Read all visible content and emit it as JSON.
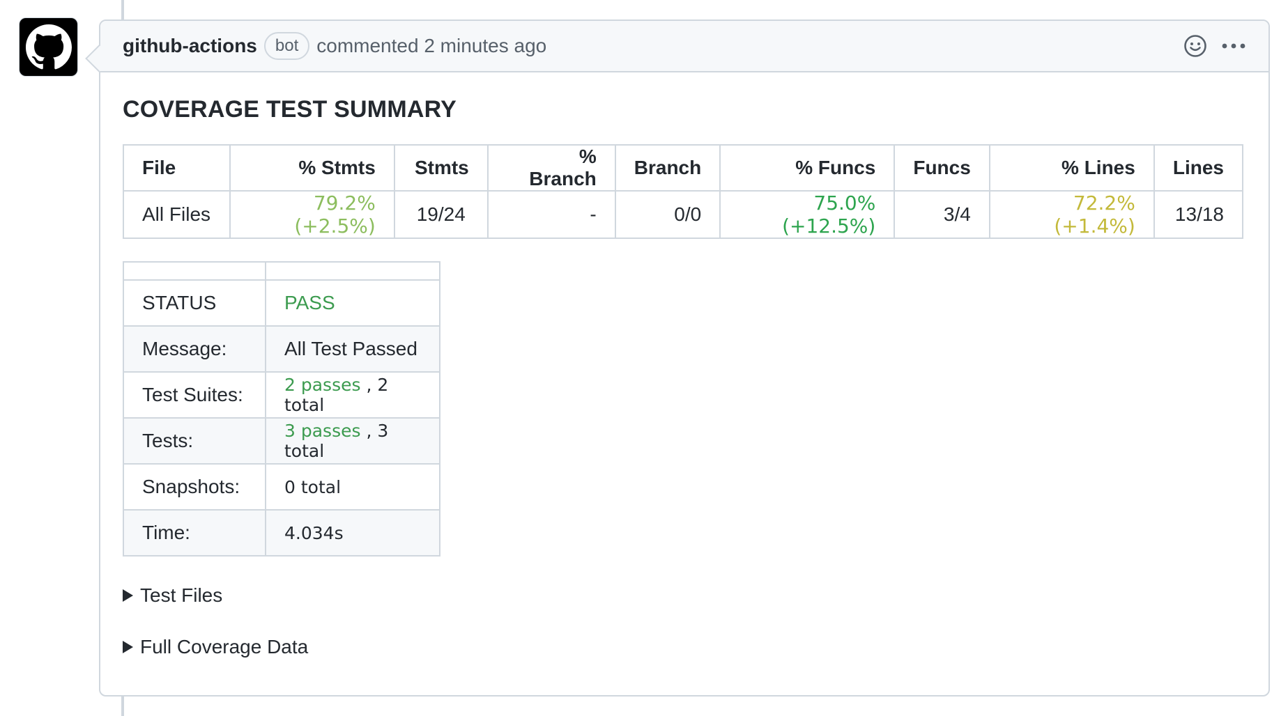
{
  "comment": {
    "author": "github-actions",
    "badge": "bot",
    "meta": "commented 2 minutes ago"
  },
  "icons": [
    "github-logo-icon",
    "smiley-icon",
    "kebab-menu-icon",
    "disclosure-triangle-icon"
  ],
  "summary": {
    "title": "COVERAGE TEST SUMMARY",
    "headers": [
      "File",
      "% Stmts",
      "Stmts",
      "% Branch",
      "Branch",
      "% Funcs",
      "Funcs",
      "% Lines",
      "Lines"
    ],
    "row": {
      "file": "All Files",
      "pct_stmts": "79.2% (+2.5%)",
      "stmts": "19/24",
      "pct_branch": "-",
      "branch": "0/0",
      "pct_funcs": "75.0% (+12.5%)",
      "funcs": "3/4",
      "pct_lines": "72.2% (+1.4%)",
      "lines": "13/18"
    }
  },
  "status_table": {
    "status_label": "STATUS",
    "status_value": "PASS",
    "message_label": "Message:",
    "message_value": "All Test Passed",
    "suites_label": "Test Suites:",
    "suites_passes": "2 passes",
    "suites_total": ", 2 total",
    "tests_label": "Tests:",
    "tests_passes": "3 passes",
    "tests_total": ", 3 total",
    "snapshots_label": "Snapshots:",
    "snapshots_value": "0 total",
    "time_label": "Time:",
    "time_value": "4.034s"
  },
  "details": {
    "test_files": "Test Files",
    "full_coverage": "Full Coverage Data"
  },
  "colors": {
    "pass": "#3c9b4f",
    "stmts": "#8cbd5e",
    "funcs": "#2da44e",
    "lines": "#c3b93a"
  }
}
